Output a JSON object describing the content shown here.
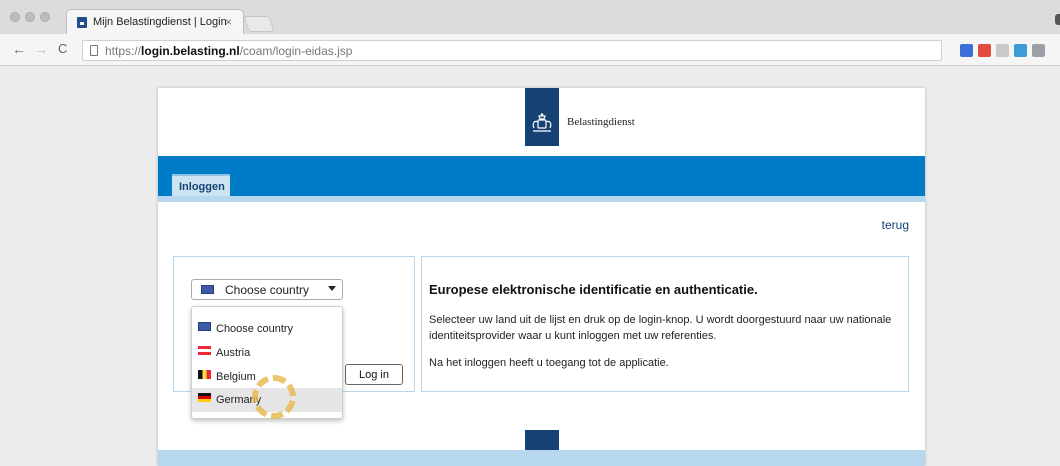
{
  "browser": {
    "tab_title": "Mijn Belastingdienst | Login",
    "tab_close": "×",
    "url_scheme": "https://",
    "url_host": "login.belasting.nl",
    "url_path": "/coam/login-eidas.jsp",
    "back_icon": "←",
    "forward_icon": "→",
    "reload_icon": "C",
    "extension_colors": [
      "#3b6fd8",
      "#e24a3b",
      "#c9c9c9",
      "#3d9bd6",
      "#9aa0a6"
    ]
  },
  "site": {
    "brand": "Belastingdienst",
    "tab": "Inloggen",
    "back_link": "terug",
    "primary_color": "#007bc7",
    "dark_blue": "#154273",
    "light_blue": "#b6d7ee"
  },
  "country_select": {
    "selected": "Choose country",
    "options": [
      {
        "label": "Choose country",
        "flag": "eu"
      },
      {
        "label": "Austria",
        "flag": "at"
      },
      {
        "label": "Belgium",
        "flag": "be"
      },
      {
        "label": "Germany",
        "flag": "de",
        "hovered": true
      }
    ]
  },
  "login_button": "Log in",
  "info": {
    "title": "Europese elektronische identificatie en authenticatie.",
    "text1": "Selecteer uw land uit de lijst en druk op de login-knop. U wordt doorgestuurd naar uw nationale identiteitsprovider waar u kunt inloggen met uw referenties.",
    "text2": "Na het inloggen heeft u toegang tot de applicatie."
  }
}
